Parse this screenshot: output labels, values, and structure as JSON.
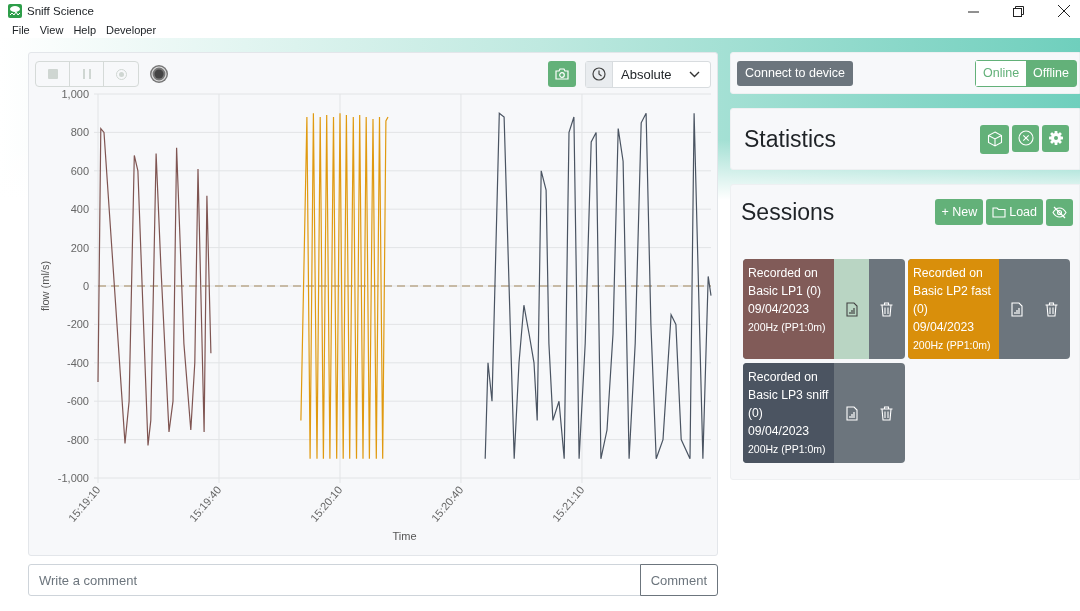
{
  "window": {
    "title": "Sniff Science"
  },
  "menu": [
    "File",
    "View",
    "Help",
    "Developer"
  ],
  "recorder": {
    "controls": [
      {
        "kind": "stop",
        "disabled": true
      },
      {
        "kind": "pause",
        "disabled": true
      },
      {
        "kind": "record",
        "disabled": true
      }
    ],
    "recording": false
  },
  "time_mode": {
    "value": "Absolute"
  },
  "chart": {
    "chart_data": {
      "type": "line",
      "grid": true,
      "ref_lines": [
        {
          "axis": "y",
          "value": 0,
          "color": "#bba98c"
        }
      ],
      "xlabel": "Time",
      "ylabel": "flow (ml/s)",
      "xlim": [
        55150,
        55302
      ],
      "ylim": [
        -1000,
        1000
      ],
      "xticks": [
        {
          "value": 55150,
          "label": "15:19:10"
        },
        {
          "value": 55180,
          "label": "15:19:40"
        },
        {
          "value": 55210,
          "label": "15:20:10"
        },
        {
          "value": 55240,
          "label": "15:20:40"
        },
        {
          "value": 55270,
          "label": "15:21:10"
        }
      ],
      "yticks": [
        {
          "value": -1000,
          "label": "-1,000"
        },
        -800,
        -600,
        -400,
        -200,
        0,
        200,
        400,
        600,
        800,
        {
          "value": 1000,
          "label": "1,000"
        }
      ],
      "x": [
        55150,
        55150.7,
        55151.5,
        55156.7,
        55157.7,
        55159.0,
        55159.9,
        55162.4,
        55163.1,
        55164.4,
        55165.6,
        55167.6,
        55168.6,
        55169.5,
        55171.3,
        55173.0,
        55174.0,
        55174.8,
        55176.3,
        55177.0,
        55178.0,
        55200.3,
        55201.8,
        55202.6,
        55203.4,
        55204.3,
        55205.1,
        55205.9,
        55206.7,
        55207.5,
        55208.4,
        55209.2,
        55210.0,
        55210.8,
        55211.6,
        55212.4,
        55213.3,
        55214.1,
        55214.9,
        55215.7,
        55216.5,
        55217.3,
        55218.2,
        55219.0,
        55219.8,
        55220.6,
        55221.4,
        55221.9,
        55246.0,
        55246.7,
        55247.7,
        55249.5,
        55250.7,
        55252.2,
        55253.2,
        55254.4,
        55255.6,
        55256.9,
        55258.1,
        55258.9,
        55259.9,
        55261.1,
        55261.8,
        55262.8,
        55264.3,
        55265.6,
        55266.8,
        55268.0,
        55269.3,
        55270.8,
        55272.3,
        55273.5,
        55274.7,
        55276.2,
        55277.7,
        55279.0,
        55280.2,
        55281.7,
        55283.2,
        55284.7,
        55285.9,
        55287.1,
        55288.4,
        55290.1,
        55292.1,
        55293.3,
        55294.6,
        55296.8,
        55297.8,
        55300.0,
        55301.3,
        55302.0
      ],
      "series": [
        {
          "color": "#7f5552",
          "values": [
            -500,
            820,
            800,
            -820,
            -600,
            680,
            600,
            -830,
            -700,
            690,
            100,
            -760,
            -600,
            720,
            -300,
            -750,
            -400,
            610,
            -760,
            470,
            -350,
            null,
            null,
            null,
            null,
            null,
            null,
            null,
            null,
            null,
            null,
            null,
            null,
            null,
            null,
            null,
            null,
            null,
            null,
            null,
            null,
            null,
            null,
            null,
            null,
            null,
            null,
            null,
            null,
            null,
            null,
            null,
            null,
            null,
            null,
            null,
            null,
            null,
            null,
            null,
            null,
            null,
            null,
            null,
            null,
            null,
            null,
            null,
            null,
            null,
            null,
            null,
            null,
            null,
            null,
            null,
            null,
            null,
            null,
            null,
            null,
            null,
            null,
            null,
            null,
            null,
            null,
            null,
            null,
            null,
            null,
            null
          ]
        },
        {
          "color": "#e09a10",
          "values": [
            null,
            null,
            null,
            null,
            null,
            null,
            null,
            null,
            null,
            null,
            null,
            null,
            null,
            null,
            null,
            null,
            null,
            null,
            null,
            null,
            null,
            -700,
            880,
            -900,
            900,
            -900,
            880,
            -900,
            890,
            -900,
            880,
            -900,
            900,
            -900,
            890,
            -900,
            880,
            -900,
            890,
            -900,
            880,
            -900,
            870,
            -900,
            880,
            -900,
            860,
            880,
            null,
            null,
            null,
            null,
            null,
            null,
            null,
            null,
            null,
            null,
            null,
            null,
            null,
            null,
            null,
            null,
            null,
            null,
            null,
            null,
            null,
            null,
            null,
            null,
            null,
            null,
            null,
            null,
            null,
            null,
            null,
            null,
            null,
            null,
            null,
            null,
            null,
            null,
            null,
            null,
            null,
            null,
            null,
            null
          ]
        },
        {
          "color": "#4a5462",
          "values": [
            null,
            null,
            null,
            null,
            null,
            null,
            null,
            null,
            null,
            null,
            null,
            null,
            null,
            null,
            null,
            null,
            null,
            null,
            null,
            null,
            null,
            null,
            null,
            null,
            null,
            null,
            null,
            null,
            null,
            null,
            null,
            null,
            null,
            null,
            null,
            null,
            null,
            null,
            null,
            null,
            null,
            null,
            null,
            null,
            null,
            null,
            null,
            null,
            -900,
            -400,
            -600,
            900,
            880,
            -200,
            -900,
            -400,
            -100,
            -250,
            -400,
            -700,
            600,
            500,
            -300,
            -700,
            -600,
            -900,
            800,
            880,
            -900,
            -300,
            750,
            800,
            -900,
            -750,
            -250,
            820,
            650,
            -900,
            -300,
            850,
            900,
            -200,
            -900,
            -800,
            -150,
            -200,
            -800,
            -900,
            900,
            -900,
            50,
            -50
          ]
        }
      ]
    }
  },
  "comment": {
    "placeholder": "Write a comment",
    "button": "Comment"
  },
  "device": {
    "button": "Connect to device",
    "modes": [
      {
        "label": "Online",
        "selected": false
      },
      {
        "label": "Offline",
        "selected": true
      }
    ]
  },
  "statistics": {
    "title": "Statistics"
  },
  "sessions": {
    "title": "Sessions",
    "new_button": "+ New",
    "load_button": "Load",
    "items": [
      {
        "title": "Recorded on Basic LP1 (0)",
        "date": "09/04/2023",
        "info": "200Hz (PP1:0m)",
        "color": "#815b58",
        "report_selected": true
      },
      {
        "title": "Recorded on Basic LP2 fast (0)",
        "date": "09/04/2023",
        "info": "200Hz (PP1:0m)",
        "color": "#d98f0b",
        "report_selected": false
      },
      {
        "title": "Recorded on Basic LP3 sniff (0)",
        "date": "09/04/2023",
        "info": "200Hz (PP1:0m)",
        "color": "#4b5461",
        "report_selected": false
      }
    ]
  }
}
